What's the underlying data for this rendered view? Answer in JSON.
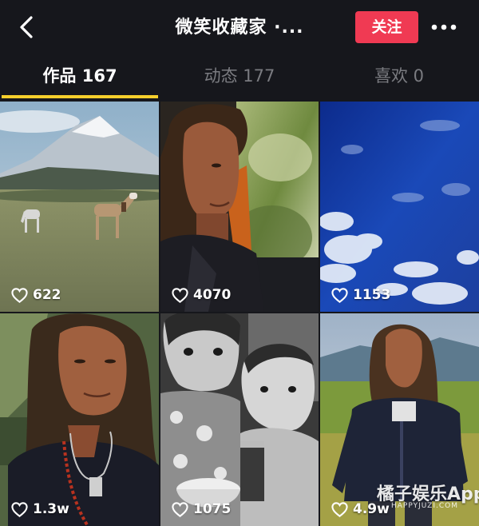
{
  "header": {
    "title": "微笑收藏家 ·...",
    "follow_label": "关注",
    "back_icon": "chevron-left-icon",
    "more_icon": "more-dots-icon"
  },
  "tabs": [
    {
      "label": "作品 167",
      "active": true
    },
    {
      "label": "动态 177",
      "active": false
    },
    {
      "label": "喜欢 0",
      "active": false
    }
  ],
  "colors": {
    "background": "#16171c",
    "follow_button": "#f03a53",
    "tab_indicator": "#f6cf2c",
    "inactive_tab": "#7a7b80"
  },
  "grid": {
    "items": [
      {
        "likes": "622",
        "subject": "horses on mountain grassland"
      },
      {
        "likes": "4070",
        "subject": "man portrait in car"
      },
      {
        "likes": "1153",
        "subject": "blue sky with clouds"
      },
      {
        "likes": "1.3w",
        "subject": "man portrait with necklace"
      },
      {
        "likes": "1075",
        "subject": "black and white children"
      },
      {
        "likes": "4.9w",
        "subject": "man standing in meadow"
      }
    ]
  },
  "watermark": {
    "main": "橘子娱乐App",
    "sub": "HAPPYJUZI.COM"
  }
}
